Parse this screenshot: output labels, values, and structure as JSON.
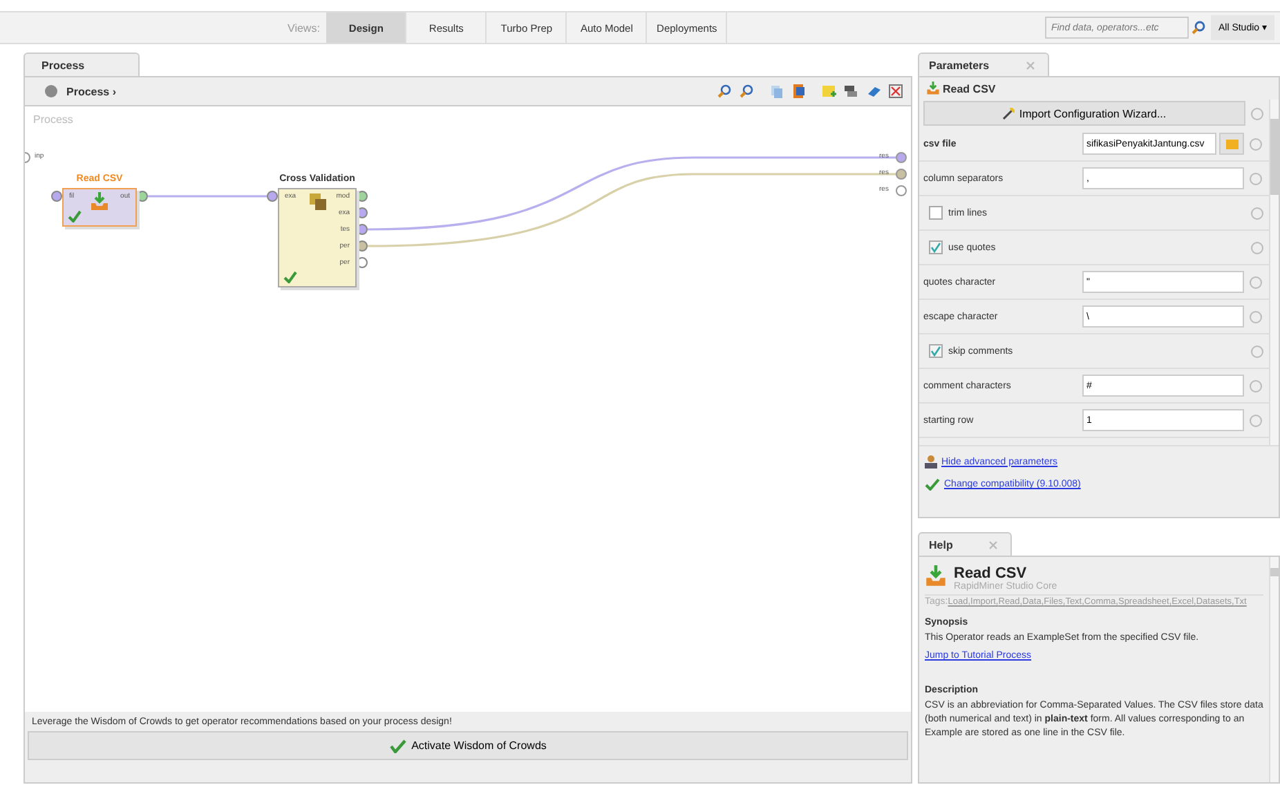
{
  "toolbar": {
    "views_label": "Views:",
    "views": [
      {
        "label": "Design",
        "selected": true
      },
      {
        "label": "Results",
        "selected": false
      },
      {
        "label": "Turbo Prep",
        "selected": false
      },
      {
        "label": "Auto Model",
        "selected": false
      },
      {
        "label": "Deployments",
        "selected": false
      }
    ],
    "search": {
      "placeholder": "Find data, operators...etc"
    },
    "scope": "All Studio ▾"
  },
  "process_panel": {
    "tab": "Process",
    "breadcrumb": "Process ›",
    "canvas_title": "Process",
    "input_port": "inp",
    "result_ports": [
      "res",
      "res",
      "res"
    ],
    "operators": [
      {
        "title": "Read CSV",
        "selected": true,
        "in_ports": [
          "fil"
        ],
        "out_ports": [
          "out"
        ],
        "ok": true
      },
      {
        "title": "Cross Validation",
        "selected": false,
        "in_ports": [
          "exa"
        ],
        "out_ports": [
          "mod",
          "exa",
          "tes",
          "per",
          "per"
        ],
        "ok": true
      }
    ],
    "hint": "Leverage the Wisdom of Crowds to get operator recommendations based on your process design!",
    "crowd_button": "Activate Wisdom of Crowds"
  },
  "parameters_panel": {
    "tab": "Parameters",
    "operator": "Read CSV",
    "wizard_button": "Import Configuration Wizard...",
    "params": [
      {
        "kind": "file",
        "label": "csv file",
        "value": "sifikasiPenyakitJantung.csv",
        "bold": true
      },
      {
        "kind": "field",
        "label": "column separators",
        "value": ",",
        "bold": false
      },
      {
        "kind": "check",
        "label": "trim lines",
        "checked": false
      },
      {
        "kind": "check",
        "label": "use quotes",
        "checked": true
      },
      {
        "kind": "field",
        "label": "quotes character",
        "value": "\"",
        "bold": false
      },
      {
        "kind": "field",
        "label": "escape character",
        "value": "\\",
        "bold": false
      },
      {
        "kind": "check",
        "label": "skip comments",
        "checked": true
      },
      {
        "kind": "field",
        "label": "comment characters",
        "value": "#",
        "bold": false
      },
      {
        "kind": "field",
        "label": "starting row",
        "value": "1",
        "bold": false
      }
    ],
    "advanced_link": "Hide advanced parameters",
    "compat_link": "Change compatibility (9.10.008)"
  },
  "help_panel": {
    "tab": "Help",
    "title": "Read CSV",
    "subtitle": "RapidMiner Studio Core",
    "tags_label": "Tags:",
    "tags": [
      "Load,",
      "Import,",
      "Read,",
      "Data,",
      "Files,",
      "Text,",
      "Comma,",
      "Spreadsheet,",
      "Excel,",
      "Datasets,",
      "Txt"
    ],
    "synopsis_heading": "Synopsis",
    "synopsis": "This Operator reads an ExampleSet from the specified CSV file.",
    "tutorial_link": "Jump to Tutorial Process",
    "description_heading": "Description",
    "description": "CSV is an abbreviation for Comma-Separated Values. The CSV files store data (both numerical and text) in **plain-text** form. All values corresponding to an Example are stored as one line in the CSV file."
  }
}
